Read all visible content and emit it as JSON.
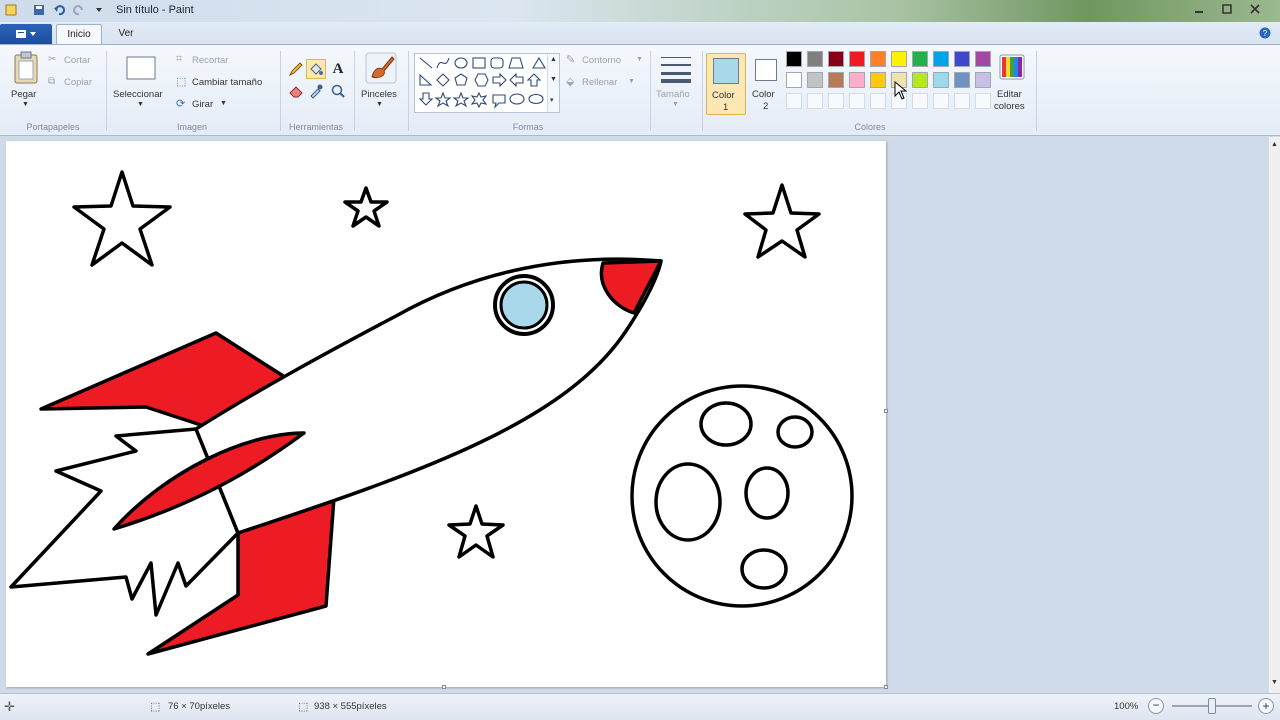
{
  "window": {
    "title": "Sin título - Paint"
  },
  "tabs": [
    {
      "label": "Inicio"
    },
    {
      "label": "Ver"
    }
  ],
  "ribbon": {
    "clipboard": {
      "paste_label": "Pegar",
      "cut_label": "Cortar",
      "copy_label": "Copiar",
      "group_label": "Portapapeles"
    },
    "image": {
      "select_label": "Seleccionar",
      "crop_label": "Recortar",
      "resize_label": "Cambiar tamaño",
      "rotate_label": "Girar",
      "group_label": "Imagen"
    },
    "tools": {
      "group_label": "Herramientas",
      "text_tool_glyph": "A"
    },
    "brushes": {
      "label": "Pinceles"
    },
    "shapes": {
      "outline_label": "Contorno",
      "fill_label": "Rellenar",
      "group_label": "Formas"
    },
    "size": {
      "label": "Tamaño"
    },
    "colors": {
      "color1_label_a": "Color",
      "color1_label_b": "1",
      "color2_label_a": "Color",
      "color2_label_b": "2",
      "edit_label_a": "Editar",
      "edit_label_b": "colores",
      "group_label": "Colores",
      "color1_value": "#a8d8ea",
      "color2_value": "#ffffff",
      "palette_row1": [
        "#000000",
        "#7f7f7f",
        "#880015",
        "#ed1c24",
        "#ff7f27",
        "#fff200",
        "#22b14c",
        "#00a2e8",
        "#3f48cc",
        "#a349a4"
      ],
      "palette_row2": [
        "#ffffff",
        "#c3c3c3",
        "#b97a57",
        "#ffaec9",
        "#ffc90e",
        "#efe4b0",
        "#b5e61d",
        "#99d9ea",
        "#7092be",
        "#c8bfe7"
      ]
    }
  },
  "status": {
    "cursor_pos": "76 × 70píxeles",
    "image_size": "938 × 555píxeles",
    "zoom": "100%"
  },
  "accent": {
    "file_menu": "#1b4e9e",
    "rocket_red": "#ed1c24",
    "window_blue": "#a8d8ea"
  }
}
